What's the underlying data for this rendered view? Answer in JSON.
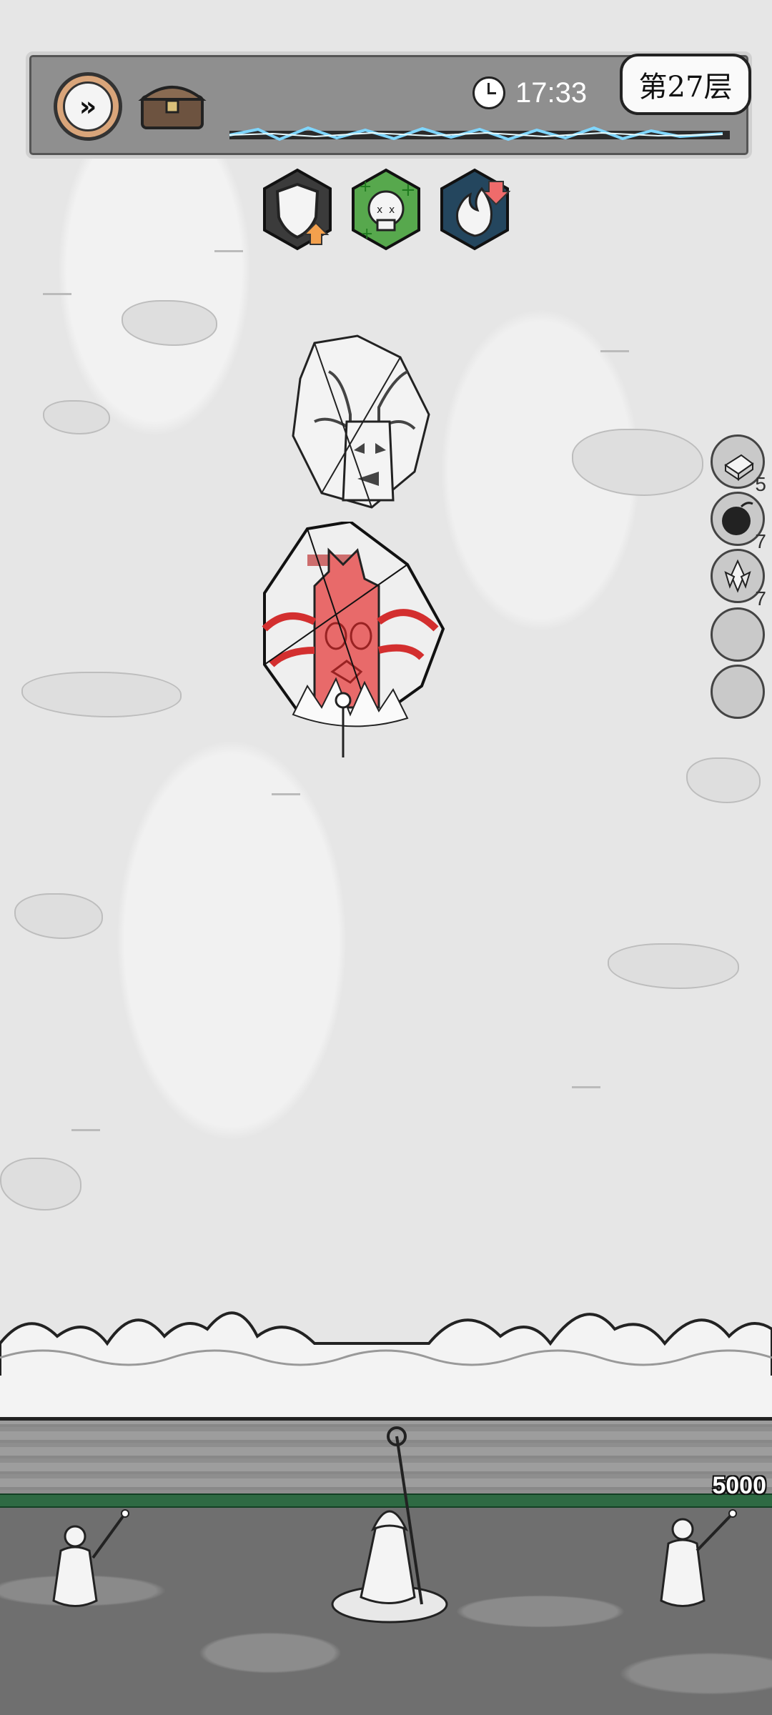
{
  "hud": {
    "time": "17:33",
    "level": "第27层"
  },
  "buffs": [
    {
      "name": "shield-up-icon"
    },
    {
      "name": "skull-heal-icon"
    },
    {
      "name": "fire-down-icon"
    }
  ],
  "side_items": [
    {
      "icon": "ice-cube-icon",
      "count": "5"
    },
    {
      "icon": "bomb-icon",
      "count": "7"
    },
    {
      "icon": "crystal-icon",
      "count": "7"
    },
    {
      "icon": "empty-slot-icon",
      "count": ""
    },
    {
      "icon": "empty-slot-icon",
      "count": ""
    }
  ],
  "base": {
    "hp": "5000"
  },
  "colors": {
    "enemy_red": "#e86a6a",
    "hp_green": "#2e6a43",
    "speed_orange": "#d9a57a"
  }
}
